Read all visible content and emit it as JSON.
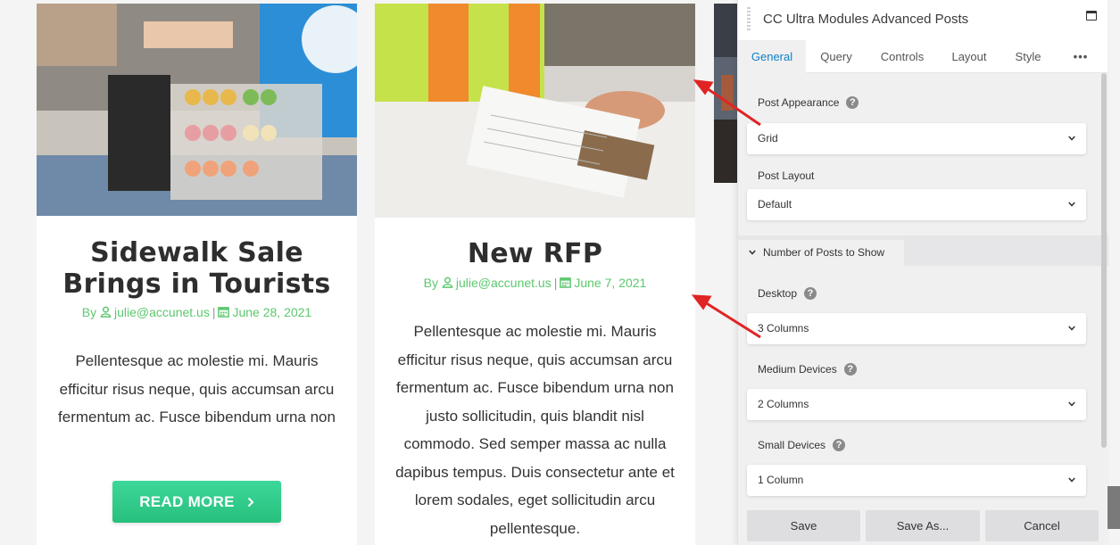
{
  "posts": [
    {
      "title": "Sidewalk Sale Brings in Tourists",
      "meta_by": "By",
      "author": "julie@accunet.us",
      "date": "June 28, 2021",
      "excerpt": "Pellentesque ac molestie mi. Mauris efficitur risus neque, quis accumsan arcu fermentum ac. Fusce bibendum urna non",
      "read_more": "READ MORE"
    },
    {
      "title": "New RFP",
      "meta_by": "By",
      "author": "julie@accunet.us",
      "date": "June 7, 2021",
      "excerpt": "Pellentesque ac molestie mi. Mauris efficitur risus neque, quis accumsan arcu fermentum ac. Fusce bibendum urna non justo sollicitudin, quis blandit nisl commodo. Sed semper massa ac nulla dapibus tempus. Duis consectetur ante et lorem sodales, eget sollicitudin arcu pellentesque."
    }
  ],
  "panel": {
    "title": "CC Ultra Modules Advanced Posts",
    "tabs": [
      "General",
      "Query",
      "Controls",
      "Layout",
      "Style",
      "•••"
    ],
    "active_tab": "General",
    "post_appearance": {
      "label": "Post Appearance",
      "value": "Grid"
    },
    "post_layout": {
      "label": "Post Layout",
      "value": "Default"
    },
    "section": "Number of Posts to Show",
    "desktop": {
      "label": "Desktop",
      "value": "3 Columns"
    },
    "medium": {
      "label": "Medium Devices",
      "value": "2 Columns"
    },
    "small": {
      "label": "Small Devices",
      "value": "1 Column"
    },
    "buttons": {
      "save": "Save",
      "save_as": "Save As...",
      "cancel": "Cancel"
    }
  },
  "colors": {
    "accent_green": "#5cc86e",
    "button_green": "#2bc483",
    "active_tab_blue": "#0e80c8",
    "annotation_arrow": "#e02424"
  },
  "icons": [
    "user-icon",
    "calendar-icon",
    "chevron-right-icon",
    "chevron-down-icon",
    "help-icon",
    "window-maximize-icon",
    "drag-handle-icon"
  ]
}
